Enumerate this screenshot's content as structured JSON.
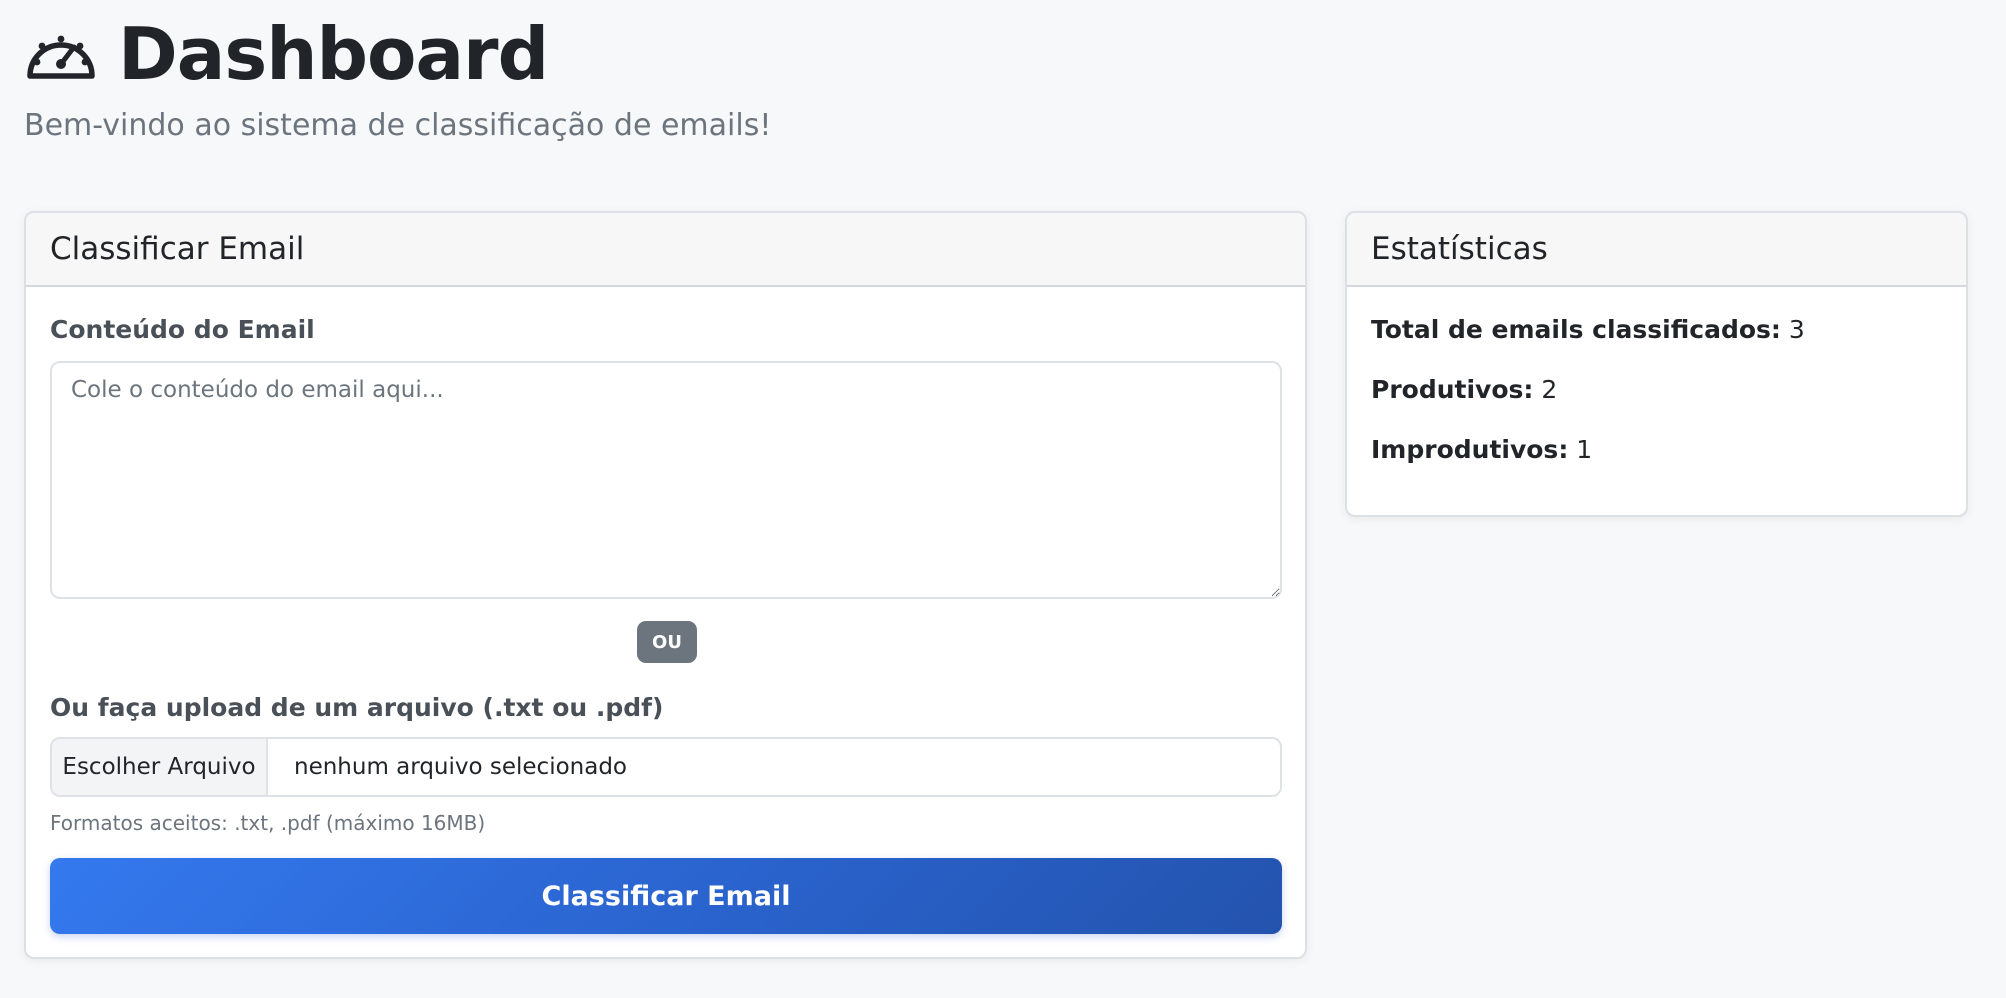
{
  "header": {
    "title": "Dashboard",
    "subtitle": "Bem-vindo ao sistema de classificação de emails!",
    "icon": "tachometer-icon"
  },
  "classify_card": {
    "title": "Classificar Email",
    "content_label": "Conteúdo do Email",
    "textarea_placeholder": "Cole o conteúdo do email aqui...",
    "textarea_value": "",
    "or_badge": "OU",
    "upload_label": "Ou faça upload de um arquivo (.txt ou .pdf)",
    "file_button_label": "Escolher Arquivo",
    "file_name": "nenhum arquivo selecionado",
    "help_text": "Formatos aceitos: .txt, .pdf (máximo 16MB)",
    "submit_label": "Classificar Email"
  },
  "stats_card": {
    "title": "Estatísticas",
    "items": [
      {
        "label": "Total de emails classificados:",
        "value": "3"
      },
      {
        "label": "Produtivos:",
        "value": "2"
      },
      {
        "label": "Improdutivos:",
        "value": "1"
      }
    ]
  },
  "colors": {
    "accent": "#3479ef",
    "accent_dark": "#2353ad",
    "badge": "#6c757d",
    "background": "#f7f8fa"
  }
}
